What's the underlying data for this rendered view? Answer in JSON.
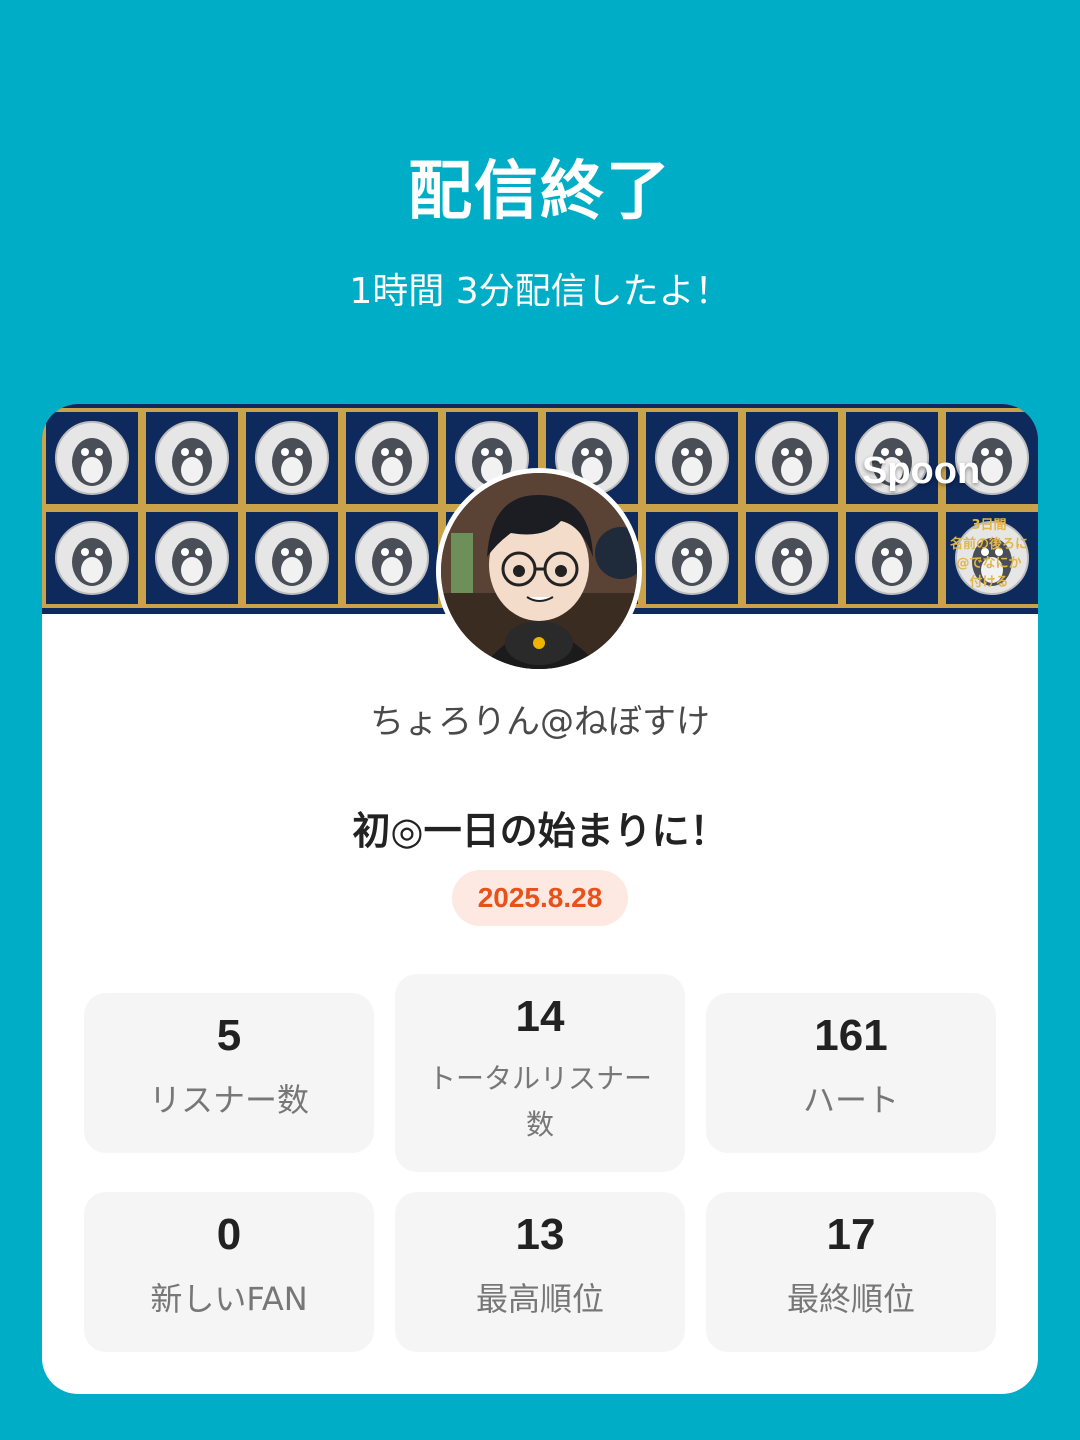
{
  "header": {
    "title": "配信終了",
    "subtitle": "1時間 3分配信したよ！"
  },
  "banner": {
    "brand": "Spoon",
    "note": "3日間\n名前の後ろに\n@でなにか\n付ける"
  },
  "profile": {
    "username": "ちょろりん@ねぼすけ",
    "stream_title": "初◎一日の始まりに！",
    "date": "2025.8.28"
  },
  "stats": [
    {
      "value": "5",
      "label": "リスナー数"
    },
    {
      "value": "14",
      "label": "トータルリスナー数"
    },
    {
      "value": "161",
      "label": "ハート"
    },
    {
      "value": "0",
      "label": "新しいFAN"
    },
    {
      "value": "13",
      "label": "最高順位"
    },
    {
      "value": "17",
      "label": "最終順位"
    }
  ],
  "colors": {
    "background": "#00adc6",
    "date_text": "#e8511a",
    "date_badge_bg": "#fde9e1",
    "banner_bg": "#0e2a5c",
    "banner_grid": "#c9a24a"
  }
}
